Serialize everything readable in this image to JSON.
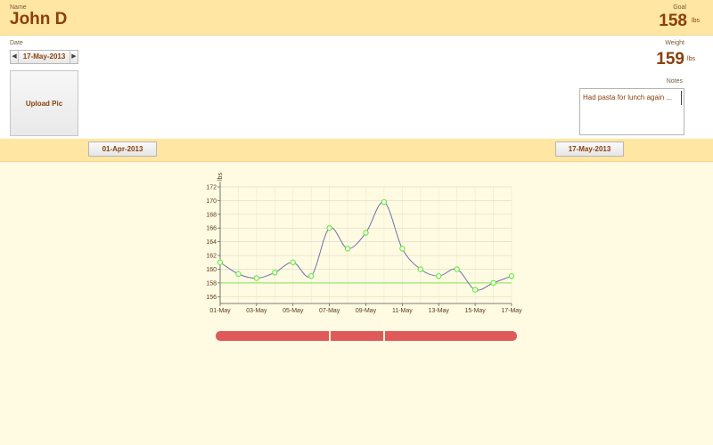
{
  "header": {
    "name_label": "Name",
    "name_value": "John D",
    "goal_label": "Goal",
    "goal_value": "158",
    "goal_unit": "lbs"
  },
  "form": {
    "date_label": "Date",
    "date_value": "17-May-2013",
    "prev_glyph": "◀",
    "next_glyph": "▶",
    "weight_label": "Weight",
    "weight_value": "159",
    "weight_unit": "lbs",
    "notes_label": "Notes",
    "notes_value": "Had pasta for lunch again ...",
    "upload_label": "Upload Pic"
  },
  "range": {
    "start": "01-Apr-2013",
    "end": "17-May-2013"
  },
  "chart_data": {
    "type": "line",
    "ylabel": "lbs",
    "ylim": [
      155,
      172
    ],
    "y_ticks": [
      156,
      158,
      160,
      162,
      164,
      166,
      168,
      170,
      172
    ],
    "x_ticks": [
      "01-May",
      "03-May",
      "05-May",
      "07-May",
      "09-May",
      "11-May",
      "13-May",
      "15-May",
      "17-May"
    ],
    "x_days": [
      1,
      2,
      3,
      4,
      5,
      6,
      7,
      8,
      9,
      10,
      11,
      12,
      13,
      14,
      15,
      16,
      17
    ],
    "values": [
      161,
      159.3,
      158.7,
      159.5,
      161,
      159,
      166,
      163,
      165.3,
      169.8,
      163,
      160,
      159,
      160,
      157,
      158,
      159
    ],
    "goal": 158,
    "line_color": "#7070aa",
    "point_color": "#66ee33",
    "goal_color": "#88dd55",
    "grid": true
  },
  "slider": {
    "color": "#e15a5a"
  }
}
